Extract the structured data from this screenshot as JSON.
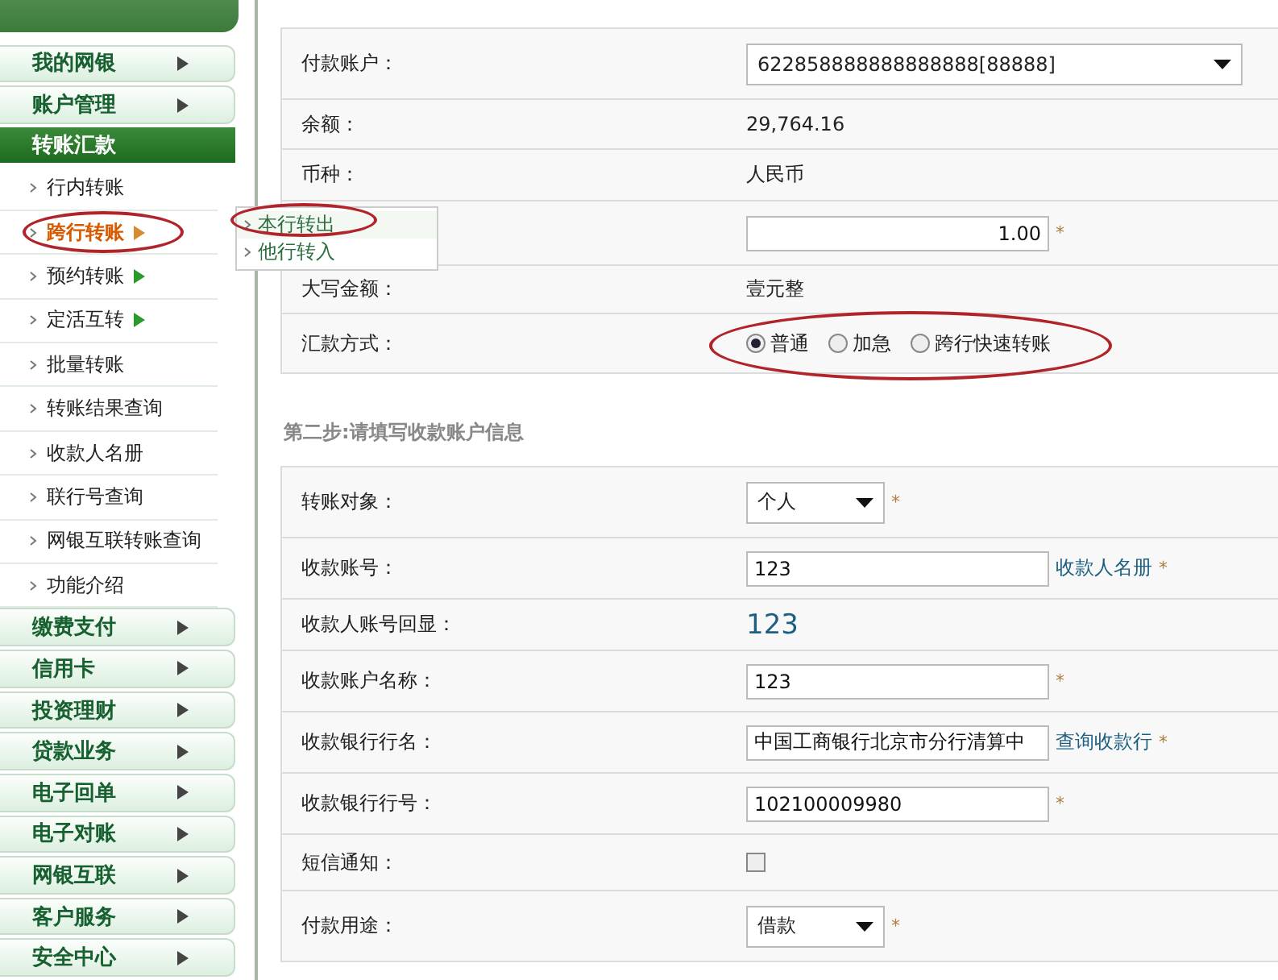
{
  "sidebar": {
    "top_menus": [
      {
        "label": "我的网银"
      },
      {
        "label": "账户管理"
      }
    ],
    "active_menu": {
      "label": "转账汇款",
      "items": [
        {
          "label": "行内转账",
          "selected": false,
          "has_submenu": false
        },
        {
          "label": "跨行转账",
          "selected": true,
          "has_submenu": true
        },
        {
          "label": "预约转账",
          "selected": false,
          "has_submenu": true
        },
        {
          "label": "定活互转",
          "selected": false,
          "has_submenu": true
        },
        {
          "label": "批量转账",
          "selected": false,
          "has_submenu": false
        },
        {
          "label": "转账结果查询",
          "selected": false,
          "has_submenu": false
        },
        {
          "label": "收款人名册",
          "selected": false,
          "has_submenu": false
        },
        {
          "label": "联行号查询",
          "selected": false,
          "has_submenu": false
        },
        {
          "label": "网银互联转账查询",
          "selected": false,
          "has_submenu": false
        },
        {
          "label": "功能介绍",
          "selected": false,
          "has_submenu": false
        }
      ]
    },
    "bottom_menus": [
      {
        "label": "缴费支付"
      },
      {
        "label": "信用卡"
      },
      {
        "label": "投资理财"
      },
      {
        "label": "贷款业务"
      },
      {
        "label": "电子回单"
      },
      {
        "label": "电子对账"
      },
      {
        "label": "网银互联"
      },
      {
        "label": "客户服务"
      },
      {
        "label": "安全中心"
      }
    ]
  },
  "submenu": {
    "items": [
      {
        "label": "本行转出",
        "selected": true
      },
      {
        "label": "他行转入",
        "selected": false
      }
    ]
  },
  "step1": {
    "rows": [
      {
        "kind": "select",
        "label": "付款账户：",
        "value": "622858888888888888[88888]"
      },
      {
        "kind": "text",
        "label": "余额：",
        "value": "29,764.16"
      },
      {
        "kind": "text",
        "label": "币种：",
        "value": "人民币"
      },
      {
        "kind": "amount",
        "value": "1.00",
        "required_mark": "*"
      },
      {
        "kind": "text",
        "label": "大写金额：",
        "value": "壹元整"
      },
      {
        "kind": "radio",
        "label": "汇款方式：",
        "options": [
          {
            "label": "普通",
            "selected": true
          },
          {
            "label": "加急",
            "selected": false
          },
          {
            "label": "跨行快速转账",
            "selected": false
          }
        ]
      }
    ]
  },
  "step2": {
    "title": "第二步:请填写收款账户信息",
    "rows": [
      {
        "kind": "select",
        "label": "转账对象：",
        "value": "个人",
        "required_mark": "*"
      },
      {
        "kind": "input",
        "label": "收款账号：",
        "value": "123",
        "link": "收款人名册",
        "required_mark": "*"
      },
      {
        "kind": "echo",
        "label": "收款人账号回显：",
        "value": "123"
      },
      {
        "kind": "input",
        "label": "收款账户名称：",
        "value": "123",
        "required_mark": "*"
      },
      {
        "kind": "input",
        "label": "收款银行行名：",
        "value": "中国工商银行北京市分行清算中",
        "link": "查询收款行",
        "required_mark": "*"
      },
      {
        "kind": "input",
        "label": "收款银行行号：",
        "value": "102100009980",
        "required_mark": "*"
      },
      {
        "kind": "checkbox",
        "label": "短信通知：",
        "checked": false
      },
      {
        "kind": "select",
        "label": "付款用途：",
        "value": "借款",
        "required_mark": "*"
      }
    ]
  }
}
